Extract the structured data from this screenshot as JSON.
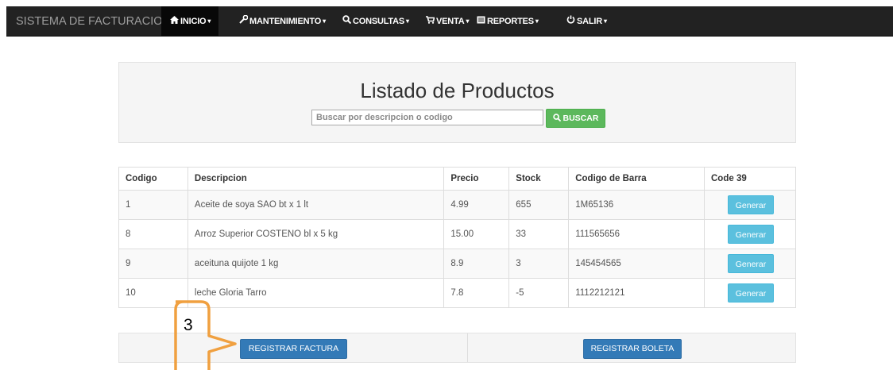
{
  "navbar": {
    "brand": "SISTEMA DE FACTURACION",
    "items": [
      {
        "label": "INICIO",
        "icon": "home-icon",
        "glyph": "⌂"
      },
      {
        "label": "MANTENIMIENTO",
        "icon": "wrench-icon",
        "glyph": "✎"
      },
      {
        "label": "CONSULTAS",
        "icon": "search-icon",
        "glyph": "🔍"
      },
      {
        "label": "VENTA",
        "icon": "cart-icon",
        "glyph": "🛒"
      },
      {
        "label": "REPORTES",
        "icon": "list-icon",
        "glyph": "▤"
      },
      {
        "label": "SALIR",
        "icon": "power-icon",
        "glyph": "⏻"
      }
    ]
  },
  "header": {
    "title": "Listado de Productos",
    "search_placeholder": "Buscar por descripcion o codigo",
    "search_button": "BUSCAR"
  },
  "table": {
    "columns": [
      "Codigo",
      "Descripcion",
      "Precio",
      "Stock",
      "Codigo de Barra",
      "Code 39"
    ],
    "rows": [
      {
        "codigo": "1",
        "descripcion": "Aceite de soya SAO bt  x 1 lt",
        "precio": "4.99",
        "stock": "655",
        "barra": "1M65136",
        "action": "Generar"
      },
      {
        "codigo": "8",
        "descripcion": "Arroz Superior COSTENO bl x 5 kg",
        "precio": "15.00",
        "stock": "33",
        "barra": "111565656",
        "action": "Generar"
      },
      {
        "codigo": "9",
        "descripcion": "aceituna quijote 1 kg",
        "precio": "8.9",
        "stock": "3",
        "barra": "145454565",
        "action": "Generar"
      },
      {
        "codigo": "10",
        "descripcion": "leche Gloria Tarro",
        "precio": "7.8",
        "stock": "-5",
        "barra": "1112212121",
        "action": "Generar"
      }
    ]
  },
  "footer": {
    "factura_button": "REGISTRAR FACTURA",
    "boleta_button": "REGISTRAR BOLETA"
  },
  "annotation": {
    "number": "3",
    "color": "#f0a040"
  },
  "colors": {
    "navbar_bg": "#222222",
    "success": "#5cb85c",
    "info": "#5bc0de",
    "primary": "#337ab7"
  }
}
